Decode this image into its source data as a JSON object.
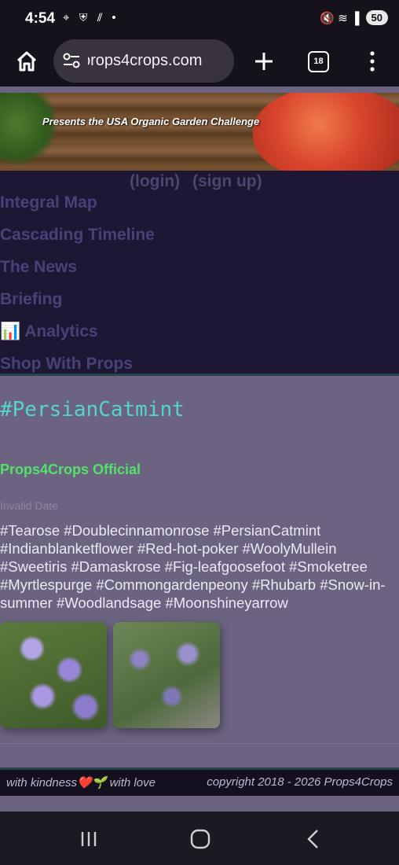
{
  "status_bar": {
    "time": "4:54",
    "left_icons": "⌖ ⛨ ⫽ •",
    "right_icons": "🔇 ≋ ▐",
    "battery": "50"
  },
  "browser": {
    "url": "props4crops.com",
    "tab_count": "18"
  },
  "banner": {
    "caption": "Presents the USA Organic Garden Challenge"
  },
  "auth": {
    "login": "(login)",
    "signup": "(sign up)"
  },
  "nav": {
    "items": [
      "Integral Map",
      "Cascading Timeline",
      "The News",
      "Briefing",
      "📊 Analytics",
      "Shop With Props"
    ]
  },
  "post": {
    "title": "#PersianCatmint",
    "author": "Props4Crops Official",
    "date": "Invalid Date",
    "tags": "#Tearose #Doublecinnamonrose #PersianCatmint #Indianblanketflower #Red-hot-poker #WoolyMullein #Sweetiris #Damaskrose #Fig-leafgoosefoot #Smoketree #Myrtlespurge #Commongardenpeony #Rhubarb #Snow-in-summer #Woodlandsage #Moonshineyarrow"
  },
  "footer": {
    "left": "with kindness❤️🌱 with love",
    "right": "copyright 2018 - 2026 Props4Crops"
  },
  "colors": {
    "page_bg": "#6b6380",
    "nav_bg": "#1d1733",
    "title": "#55d6c5",
    "author": "#54e06b"
  }
}
